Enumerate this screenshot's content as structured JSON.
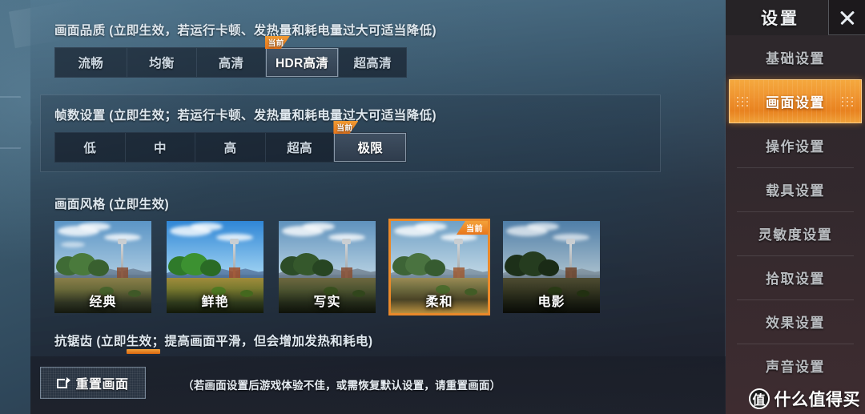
{
  "sections": {
    "quality": {
      "title": "画面品质 (立即生效，若运行卡顿、发热量和耗电量过大可适当降低)",
      "options": [
        "流畅",
        "均衡",
        "高清",
        "HDR高清",
        "超高清"
      ],
      "selected_index": 3,
      "current_badge": "当前"
    },
    "framerate": {
      "title": "帧数设置 (立即生效；若运行卡顿、发热量和耗电量过大可适当降低)",
      "options": [
        "低",
        "中",
        "高",
        "超高",
        "极限"
      ],
      "selected_index": 4,
      "current_badge": "当前"
    },
    "style": {
      "title": "画面风格 (立即生效)",
      "options": [
        "经典",
        "鲜艳",
        "写实",
        "柔和",
        "电影"
      ],
      "selected_index": 3,
      "current_badge": "当前"
    },
    "antialias": {
      "title": "抗锯齿 (立即生效；提高画面平滑，但会增加发热和耗电)"
    }
  },
  "bottom": {
    "reset_label": "重置画面",
    "reset_hint": "（若画面设置后游戏体验不佳，或需恢复默认设置，请重置画面）"
  },
  "sidebar": {
    "title": "设置",
    "close_icon": "close-icon",
    "items": [
      {
        "label": "基础设置",
        "active": false
      },
      {
        "label": "画面设置",
        "active": true
      },
      {
        "label": "操作设置",
        "active": false
      },
      {
        "label": "载具设置",
        "active": false
      },
      {
        "label": "灵敏度设置",
        "active": false
      },
      {
        "label": "拾取设置",
        "active": false
      },
      {
        "label": "效果设置",
        "active": false
      },
      {
        "label": "声音设置",
        "active": false
      }
    ]
  },
  "watermark": {
    "logo": "值",
    "text": "什么值得买"
  },
  "colors": {
    "accent_orange": "#e8821f",
    "badge_orange": "#ef8f2a",
    "panel_dark": "#222b38",
    "text_light": "#dfe8ef",
    "sidebar_bg": "#322a2e"
  }
}
